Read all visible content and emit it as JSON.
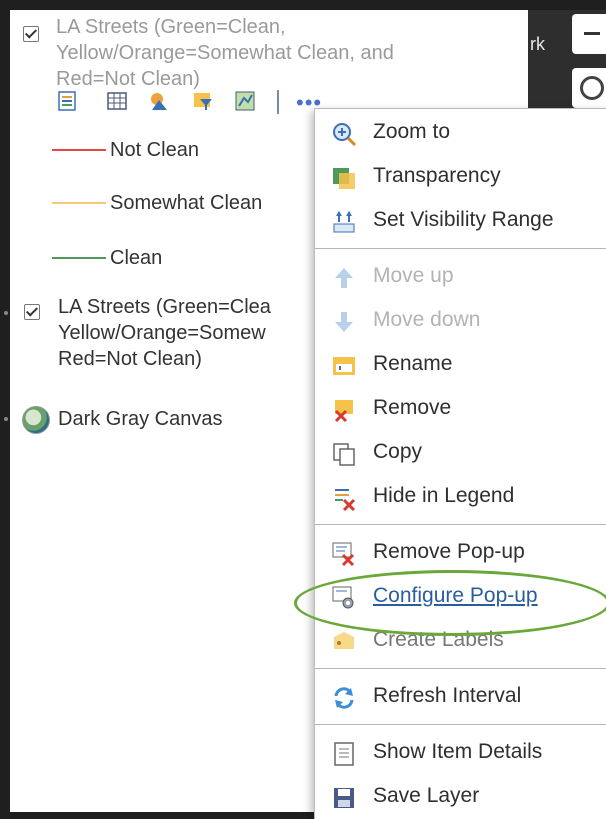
{
  "map": {
    "side_label": "rk"
  },
  "layer1": {
    "title_lines": [
      "LA Streets (Green=Clean,",
      "Yellow/Orange=Somewhat Clean, and",
      "Red=Not Clean)"
    ]
  },
  "legend": [
    {
      "label": "Not Clean",
      "color": "#e84545"
    },
    {
      "label": "Somewhat Clean",
      "color": "#f5c97a"
    },
    {
      "label": "Clean",
      "color": "#4f9a5a"
    }
  ],
  "toolbar": {
    "icons": [
      "legend-icon",
      "table-icon",
      "symbol-icon",
      "filter-icon",
      "map-edit-icon"
    ],
    "more_label": "•••"
  },
  "layer2": {
    "title_lines": [
      "LA Streets (Green=Clea",
      "Yellow/Orange=Somew",
      "Red=Not Clean)"
    ]
  },
  "basemap": {
    "label": "Dark Gray Canvas"
  },
  "menu": {
    "items": [
      {
        "label": "Zoom to",
        "icon": "zoom-to-icon",
        "state": "normal"
      },
      {
        "label": "Transparency",
        "icon": "transparency-icon",
        "state": "normal"
      },
      {
        "label": "Set Visibility Range",
        "icon": "visibility-range-icon",
        "state": "normal"
      },
      {
        "label": "Move up",
        "icon": "arrow-up-icon",
        "state": "disabled"
      },
      {
        "label": "Move down",
        "icon": "arrow-down-icon",
        "state": "disabled"
      },
      {
        "label": "Rename",
        "icon": "rename-icon",
        "state": "normal"
      },
      {
        "label": "Remove",
        "icon": "remove-icon",
        "state": "normal"
      },
      {
        "label": "Copy",
        "icon": "copy-icon",
        "state": "normal"
      },
      {
        "label": "Hide in Legend",
        "icon": "hide-legend-icon",
        "state": "normal"
      },
      {
        "label": "Remove Pop-up",
        "icon": "remove-popup-icon",
        "state": "normal"
      },
      {
        "label": "Configure Pop-up",
        "icon": "configure-popup-icon",
        "state": "highlighted"
      },
      {
        "label": "Create Labels",
        "icon": "create-labels-icon",
        "state": "partial"
      },
      {
        "label": "Refresh Interval",
        "icon": "refresh-icon",
        "state": "normal"
      },
      {
        "label": "Show Item Details",
        "icon": "item-details-icon",
        "state": "normal"
      },
      {
        "label": "Save Layer",
        "icon": "save-icon",
        "state": "normal"
      }
    ]
  },
  "colors": {
    "accent_link": "#2a5d9e",
    "highlight": "#6aa83a"
  }
}
